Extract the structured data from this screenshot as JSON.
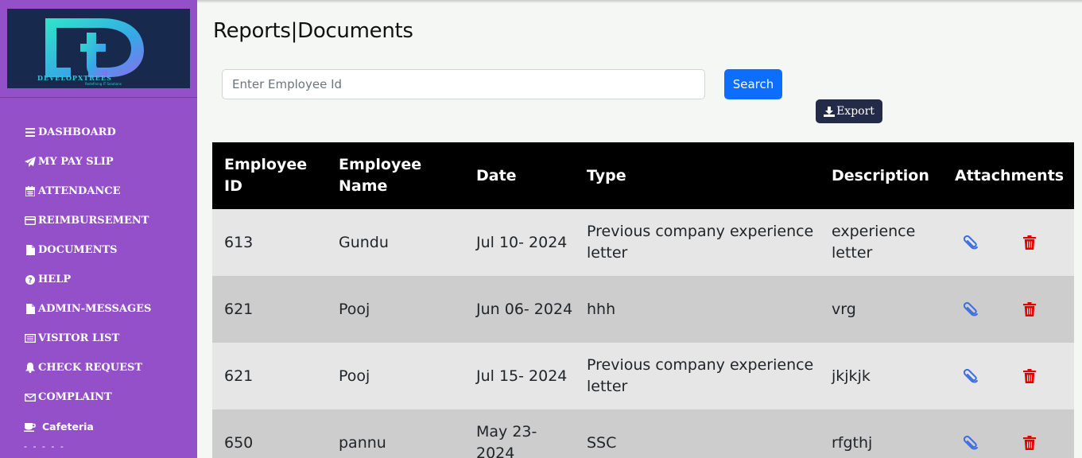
{
  "brand": {
    "logo_text": "DEVELOPXTREES",
    "logo_tagline": "Redefining IT Solutions",
    "primary": "#9450c8",
    "accent": "#0d6efd",
    "danger": "#e00000"
  },
  "sidebar": {
    "items": [
      {
        "label": "DASHBOARD",
        "icon": "bars-icon"
      },
      {
        "label": "MY PAY SLIP",
        "icon": "paper-plane-icon"
      },
      {
        "label": "ATTENDANCE",
        "icon": "calendar-icon"
      },
      {
        "label": "REIMBURSEMENT",
        "icon": "credit-card-icon"
      },
      {
        "label": "DOCUMENTS",
        "icon": "file-icon"
      },
      {
        "label": "HELP",
        "icon": "question-circle-icon"
      },
      {
        "label": "ADMIN-MESSAGES",
        "icon": "file-icon"
      },
      {
        "label": "VISITOR LIST",
        "icon": "list-alt-icon"
      },
      {
        "label": "CHECK REQUEST",
        "icon": "bell-icon"
      },
      {
        "label": "COMPLAINT",
        "icon": "envelope-icon"
      },
      {
        "label": "Cafeteria",
        "icon": "coffee-icon"
      }
    ]
  },
  "page": {
    "title": "Reports|Documents"
  },
  "search": {
    "placeholder": "Enter Employee Id",
    "value": "",
    "button_label": "Search"
  },
  "export": {
    "label": "Export",
    "icon": "download-icon"
  },
  "table": {
    "headers": [
      "Employee ID",
      "Employee Name",
      "Date",
      "Type",
      "Description",
      "Attachments"
    ],
    "rows": [
      {
        "id": "613",
        "name": "Gundu",
        "date": "Jul 10- 2024",
        "type": "Previous company experience letter",
        "description": "experience letter"
      },
      {
        "id": "621",
        "name": "Pooj",
        "date": "Jun 06- 2024",
        "type": "hhh",
        "description": "vrg"
      },
      {
        "id": "621",
        "name": "Pooj",
        "date": "Jul 15- 2024",
        "type": "Previous company experience letter",
        "description": "jkjkjk"
      },
      {
        "id": "650",
        "name": "pannu",
        "date": "May 23- 2024",
        "type": "SSC",
        "description": "rfgthj"
      }
    ]
  }
}
